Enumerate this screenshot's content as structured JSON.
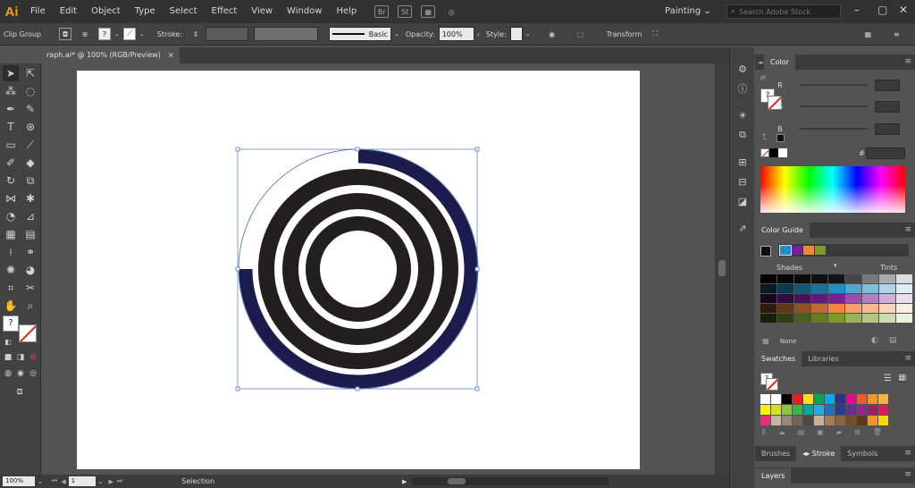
{
  "app": {
    "logo": "Ai",
    "workspace": "Painting ⌄",
    "search_placeholder": "Search Adobe Stock"
  },
  "menu": [
    "File",
    "Edit",
    "Object",
    "Type",
    "Select",
    "Effect",
    "View",
    "Window",
    "Help"
  ],
  "menubar_icons": {
    "bridge": "Br",
    "stock": "St"
  },
  "control": {
    "selection_type": "Clip Group",
    "stroke_label": "Stroke:",
    "brush_label": "Basic",
    "opacity_label": "Opacity:",
    "opacity_value": "100%",
    "style_label": "Style:",
    "transform_label": "Transform"
  },
  "document": {
    "tab_title": "raph.ai* @ 100% (RGB/Preview)",
    "close": "×"
  },
  "status": {
    "zoom": "100%",
    "artboard": "1",
    "tool": "Selection"
  },
  "panels": {
    "color": {
      "title": "Color",
      "labels": [
        "R",
        "G",
        "B"
      ],
      "hex_label": "#"
    },
    "color_guide": {
      "title": "Color Guide",
      "shades": "Shades",
      "tints": "Tints",
      "none_label": "None",
      "harmony": [
        "#1f8fc6",
        "#7a1f9a",
        "#f2863a",
        "#7d9c2a"
      ]
    },
    "swatches": {
      "tabs": [
        "Swatches",
        "Libraries"
      ]
    },
    "bottom_tabs": {
      "brushes": "Brushes",
      "stroke": "Stroke",
      "symbols": "Symbols",
      "layers": "Layers"
    }
  },
  "colors": {
    "ring_dark": "#231f20",
    "ring_arc": "#1b1b4d",
    "accent": "#ff9a00"
  }
}
